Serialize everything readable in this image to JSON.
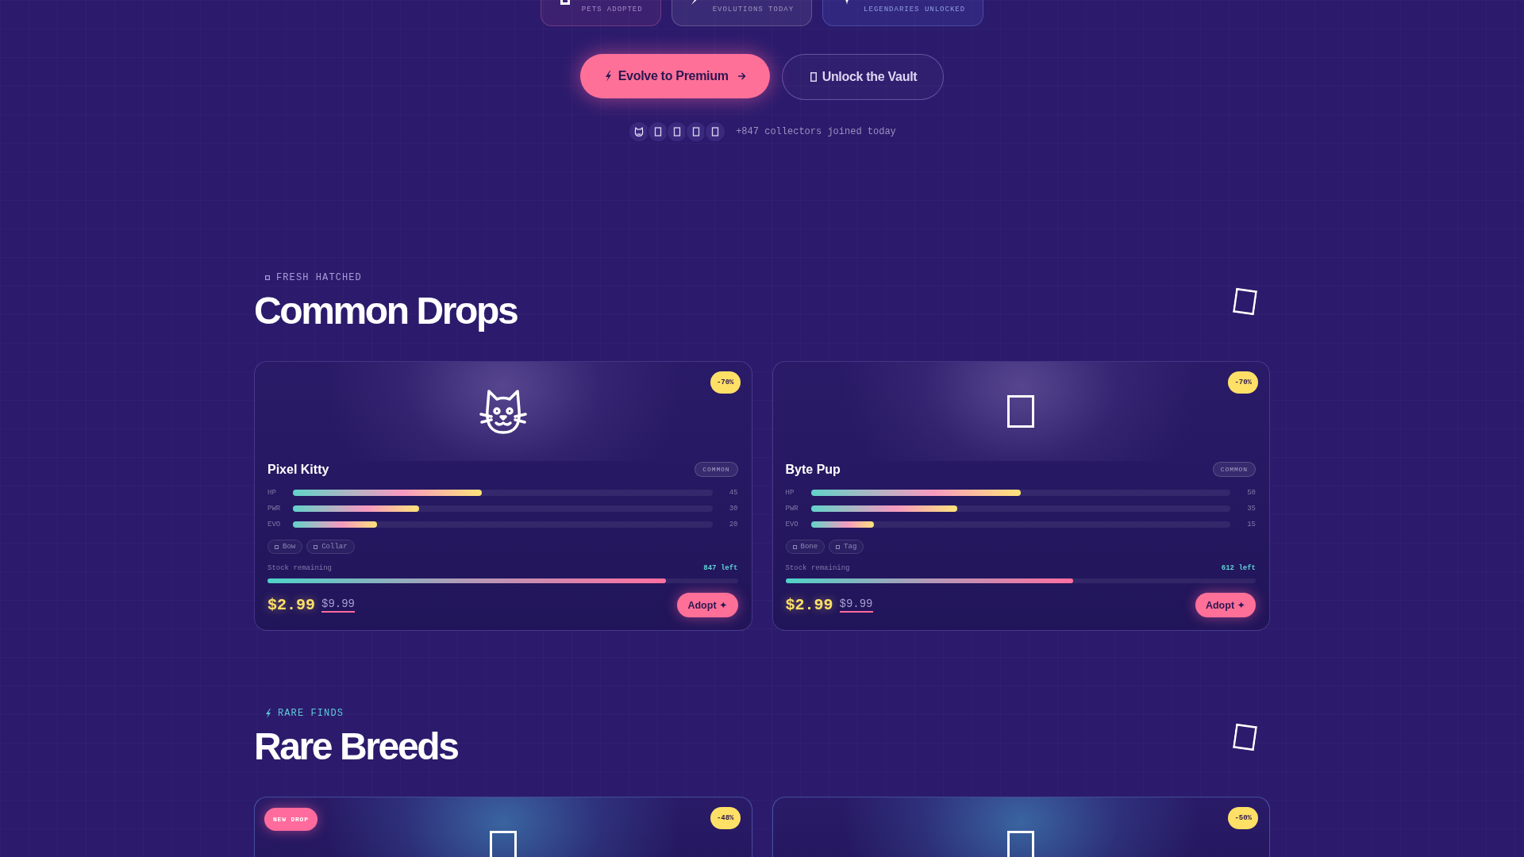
{
  "stats": [
    {
      "kind": "blank",
      "label": "PETS ADOPTED"
    },
    {
      "kind": "bolt",
      "label": "EVOLUTIONS TODAY"
    },
    {
      "kind": "sparkle",
      "label": "LEGENDARIES UNLOCKED"
    }
  ],
  "actions": [
    {
      "kind": "primary",
      "label": "Evolve to Premium"
    },
    {
      "kind": "secondary",
      "label": "Unlock the Vault"
    }
  ],
  "social": {
    "avatars": [
      {
        "kind": "cat"
      },
      {
        "kind": "blank"
      },
      {
        "kind": "blank"
      },
      {
        "kind": "blank"
      },
      {
        "kind": "blank"
      }
    ],
    "text": "+847 collectors joined today"
  },
  "sections": [
    {
      "kind": "common",
      "eyebrow": "FRESH HATCHED",
      "title": "Common Drops",
      "pets": [
        {
          "kind": "cat",
          "discount": "-70%",
          "name": "Pixel Kitty",
          "rarity": "COMMON",
          "stats": [
            {
              "label": "HP",
              "level": 0.45,
              "value": "45"
            },
            {
              "label": "PWR",
              "level": 0.3,
              "value": "30"
            },
            {
              "label": "EVO",
              "level": 0.2,
              "value": "20"
            }
          ],
          "tags": [
            "Bow",
            "Collar"
          ],
          "stock": {
            "label": "Stock remaining",
            "reading": "847 left",
            "level": 0.847
          },
          "price": "$2.99",
          "old_price": "$9.99",
          "button": "Adopt ✦"
        },
        {
          "kind": "blank",
          "discount": "-70%",
          "name": "Byte Pup",
          "rarity": "COMMON",
          "stats": [
            {
              "label": "HP",
              "level": 0.5,
              "value": "50"
            },
            {
              "label": "PWR",
              "level": 0.35,
              "value": "35"
            },
            {
              "label": "EVO",
              "level": 0.15,
              "value": "15"
            }
          ],
          "tags": [
            "Bone",
            "Tag"
          ],
          "stock": {
            "label": "Stock remaining",
            "reading": "612 left",
            "level": 0.612
          },
          "price": "$2.99",
          "old_price": "$9.99",
          "button": "Adopt ✦"
        }
      ]
    },
    {
      "kind": "rare",
      "eyebrow": "RARE FINDS",
      "title": "Rare Breeds",
      "pets": [
        {
          "kind": "blank",
          "badge": "NEW DROP",
          "discount": "-48%"
        },
        {
          "kind": "blank",
          "discount": "-50%"
        }
      ]
    }
  ]
}
